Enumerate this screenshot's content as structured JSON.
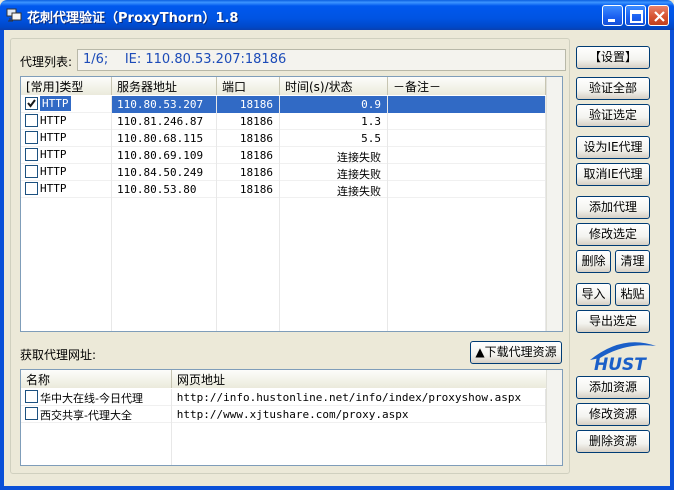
{
  "window": {
    "title": "花刺代理验证（ProxyThorn）1.8"
  },
  "proxy_section": {
    "label": "代理列表:",
    "info": "1/6;    IE: 110.80.53.207:18186",
    "columns": [
      "[常用]类型",
      "服务器地址",
      "端口",
      "时间(s)/状态",
      "－备注－"
    ],
    "rows": [
      {
        "checked": true,
        "type": "HTTP",
        "address": "110.80.53.207",
        "port": "18186",
        "status": "0.9",
        "note": "",
        "selected": true
      },
      {
        "checked": false,
        "type": "HTTP",
        "address": "110.81.246.87",
        "port": "18186",
        "status": "1.3",
        "note": ""
      },
      {
        "checked": false,
        "type": "HTTP",
        "address": "110.80.68.115",
        "port": "18186",
        "status": "5.5",
        "note": ""
      },
      {
        "checked": false,
        "type": "HTTP",
        "address": "110.80.69.109",
        "port": "18186",
        "status": "连接失败",
        "note": ""
      },
      {
        "checked": false,
        "type": "HTTP",
        "address": "110.84.50.249",
        "port": "18186",
        "status": "连接失败",
        "note": ""
      },
      {
        "checked": false,
        "type": "HTTP",
        "address": "110.80.53.80",
        "port": "18186",
        "status": "连接失败",
        "note": ""
      }
    ]
  },
  "source_section": {
    "label": "获取代理网址:",
    "download_button": "▲下载代理资源",
    "columns": [
      "名称",
      "网页地址"
    ],
    "rows": [
      {
        "checked": false,
        "name": "华中大在线-今日代理",
        "url": "http://info.hustonline.net/info/index/proxyshow.aspx"
      },
      {
        "checked": false,
        "name": "西交共享-代理大全",
        "url": "http://www.xjtushare.com/proxy.aspx"
      }
    ]
  },
  "buttons": {
    "settings": "【设置】",
    "verify_all": "验证全部",
    "verify_selected": "验证选定",
    "set_ie_proxy": "设为IE代理",
    "cancel_ie_proxy": "取消IE代理",
    "add_proxy": "添加代理",
    "edit_selected": "修改选定",
    "delete": "删除",
    "clear": "清理",
    "import": "导入",
    "paste": "粘贴",
    "export_selected": "导出选定",
    "add_source": "添加资源",
    "edit_source": "修改资源",
    "delete_source": "删除资源"
  },
  "logo_text": "HUST",
  "colors": {
    "titlebar": "#0054e3",
    "selection": "#316ac5",
    "info_text": "#1c4bb8",
    "window_bg": "#ece9d8"
  }
}
